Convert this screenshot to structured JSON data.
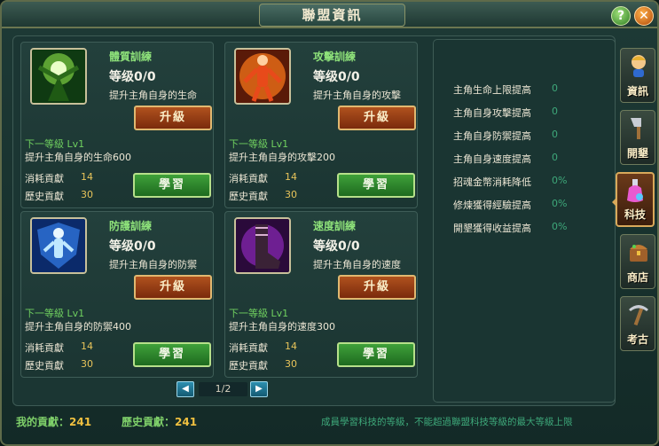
{
  "window": {
    "title": "聯盟資訊",
    "help_label": "?",
    "close_label": "✕"
  },
  "cards": [
    {
      "name": "體質訓練",
      "level": "等级0/0",
      "desc": "提升主角自身的生命",
      "upgrade_label": "升級",
      "next_label": "下一等級 Lv1",
      "next_desc": "提升主角自身的生命600",
      "cost_label": "消耗貢獻",
      "cost_value": "14",
      "history_label": "歷史貢獻",
      "history_value": "30",
      "learn_label": "學習"
    },
    {
      "name": "攻擊訓練",
      "level": "等级0/0",
      "desc": "提升主角自身的攻擊",
      "upgrade_label": "升級",
      "next_label": "下一等級 Lv1",
      "next_desc": "提升主角自身的攻擊200",
      "cost_label": "消耗貢獻",
      "cost_value": "14",
      "history_label": "歷史貢獻",
      "history_value": "30",
      "learn_label": "學習"
    },
    {
      "name": "防護訓練",
      "level": "等级0/0",
      "desc": "提升主角自身的防禦",
      "upgrade_label": "升級",
      "next_label": "下一等級 Lv1",
      "next_desc": "提升主角自身的防禦400",
      "cost_label": "消耗貢獻",
      "cost_value": "14",
      "history_label": "歷史貢獻",
      "history_value": "30",
      "learn_label": "學習"
    },
    {
      "name": "速度訓練",
      "level": "等级0/0",
      "desc": "提升主角自身的速度",
      "upgrade_label": "升級",
      "next_label": "下一等級 Lv1",
      "next_desc": "提升主角自身的速度300",
      "cost_label": "消耗貢獻",
      "cost_value": "14",
      "history_label": "歷史貢獻",
      "history_value": "30",
      "learn_label": "學習"
    }
  ],
  "pager": {
    "text": "1/2",
    "prev": "◀",
    "next": "▶"
  },
  "stats": [
    {
      "label": "主角生命上限提高",
      "value": "0"
    },
    {
      "label": "主角自身攻擊提高",
      "value": "0"
    },
    {
      "label": "主角自身防禦提高",
      "value": "0"
    },
    {
      "label": "主角自身速度提高",
      "value": "0"
    },
    {
      "label": "招魂金幣消耗降低",
      "value": "0%"
    },
    {
      "label": "修煉獲得經驗提高",
      "value": "0%"
    },
    {
      "label": "開墾獲得收益提高",
      "value": "0%"
    }
  ],
  "footer": {
    "my_contrib_label": "我的貢獻：",
    "my_contrib_value": "241",
    "history_label": "歷史貢獻：",
    "history_value": "241",
    "note": "成員學習科技的等級，不能超過聯盟科技等級的最大等級上限"
  },
  "side_tabs": [
    {
      "label": "資訊",
      "icon": "character-icon",
      "active": false
    },
    {
      "label": "開墾",
      "icon": "axe-icon",
      "active": false
    },
    {
      "label": "科技",
      "icon": "potion-icon",
      "active": true
    },
    {
      "label": "商店",
      "icon": "chest-icon",
      "active": false
    },
    {
      "label": "考古",
      "icon": "pickaxe-icon",
      "active": false
    }
  ],
  "colors": {
    "accent_green": "#8ee27a",
    "gold": "#f0c040",
    "upgrade_orange": "#b0521e",
    "learn_green": "#3fa13a"
  }
}
